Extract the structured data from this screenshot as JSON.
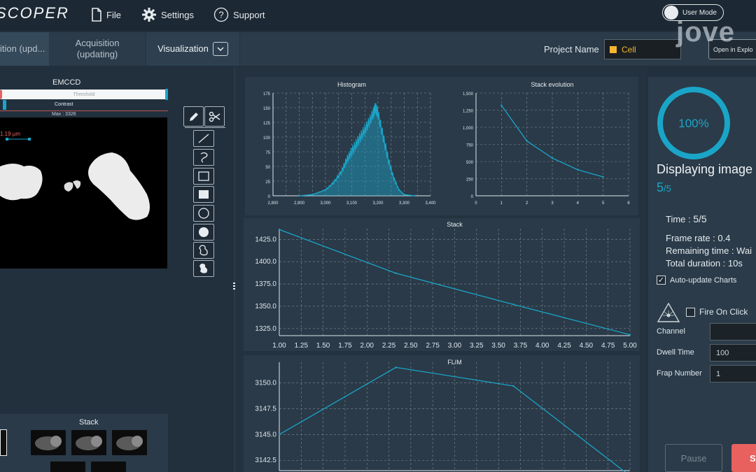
{
  "app": {
    "title": "SCOPER"
  },
  "menu": {
    "file": "File",
    "settings": "Settings",
    "support": "Support"
  },
  "user_mode": {
    "label": "User Mode"
  },
  "tabs": {
    "first": "ition (upd...",
    "acquisition_line1": "Acquisition",
    "acquisition_line2": "(updating)",
    "visualization": "Visualization"
  },
  "project": {
    "label": "Project Name",
    "value": "Cell",
    "open_button": "Open in Explo"
  },
  "watermark": "jove",
  "camera": {
    "name": "EMCCD",
    "threshold_label": "Threshold",
    "contrast_label": "Contrast",
    "max_label": "Max : 3326",
    "scale_label": "1.19 µm"
  },
  "stack_panel": {
    "label": "Stack"
  },
  "right": {
    "progress_text": "100%",
    "progress_value": 1.0,
    "displaying_label": "Displaying image",
    "image_index": "5",
    "image_total": "/5",
    "time_label": "Time : ",
    "time_value": "5/5",
    "frame_rate": "Frame rate : 0.4",
    "remaining": "Remaining time : Wai",
    "duration": "Total duration : 10s",
    "auto_update": "Auto-update Charts",
    "fire_on_click": "Fire On Click",
    "channel_label": "Channel",
    "channel_value": "",
    "dwell_label": "Dwell Time",
    "dwell_value": "100",
    "frap_label": "Frap Number",
    "frap_value": "1",
    "pause": "Pause",
    "start": "S"
  },
  "colors": {
    "accent": "#1aa5c8",
    "background": "#22303d",
    "start_button": "#e8615f",
    "project_text": "#f2b630"
  },
  "chart_data": [
    {
      "type": "area",
      "title": "Histogram",
      "xlim": [
        2800,
        3400
      ],
      "ylim": [
        0,
        175
      ],
      "x_ticks": [
        "2,800",
        "2,900",
        "3,000",
        "3,100",
        "3,200",
        "3,300",
        "3,400"
      ],
      "y_ticks": [
        "0",
        "25",
        "50",
        "75",
        "100",
        "125",
        "150",
        "175"
      ],
      "x": [
        2900,
        2950,
        3000,
        3030,
        3060,
        3080,
        3100,
        3120,
        3140,
        3160,
        3180,
        3190,
        3200,
        3220,
        3240,
        3260,
        3280,
        3300,
        3340
      ],
      "values": [
        0,
        2,
        10,
        22,
        40,
        60,
        75,
        90,
        105,
        120,
        138,
        150,
        140,
        100,
        60,
        30,
        10,
        2,
        0
      ]
    },
    {
      "type": "line",
      "title": "Stack evolution",
      "xlim": [
        0,
        6
      ],
      "ylim": [
        0,
        1500
      ],
      "x_ticks": [
        "0",
        "1",
        "2",
        "3",
        "4",
        "5",
        "6"
      ],
      "y_ticks": [
        "0",
        "250",
        "500",
        "750",
        "1,000",
        "1,250",
        "1,500"
      ],
      "x": [
        1,
        2,
        3,
        4,
        5
      ],
      "values": [
        1320,
        800,
        550,
        380,
        275
      ]
    },
    {
      "type": "line",
      "title": "Stack",
      "xlim": [
        1,
        5
      ],
      "ylim": [
        1317,
        1437
      ],
      "x_ticks": [
        "1.00",
        "1.25",
        "1.50",
        "1.75",
        "2.00",
        "2.25",
        "2.50",
        "2.75",
        "3.00",
        "3.25",
        "3.50",
        "3.75",
        "4.00",
        "4.25",
        "4.50",
        "4.75",
        "5.00"
      ],
      "y_ticks": [
        "1325.0",
        "1350.0",
        "1375.0",
        "1400.0",
        "1425.0"
      ],
      "x": [
        1,
        2.33,
        3.67,
        5
      ],
      "values": [
        1436,
        1387,
        1352,
        1318
      ]
    },
    {
      "type": "line",
      "title": "FLIM",
      "xlim": [
        1,
        5
      ],
      "ylim": [
        3141.5,
        3152
      ],
      "x_ticks": [],
      "y_ticks": [
        "3142.5",
        "3145.0",
        "3147.5",
        "3150.0"
      ],
      "x": [
        1,
        2.33,
        3.67,
        5
      ],
      "values": [
        3145.0,
        3151.5,
        3149.7,
        3141.0
      ]
    }
  ]
}
